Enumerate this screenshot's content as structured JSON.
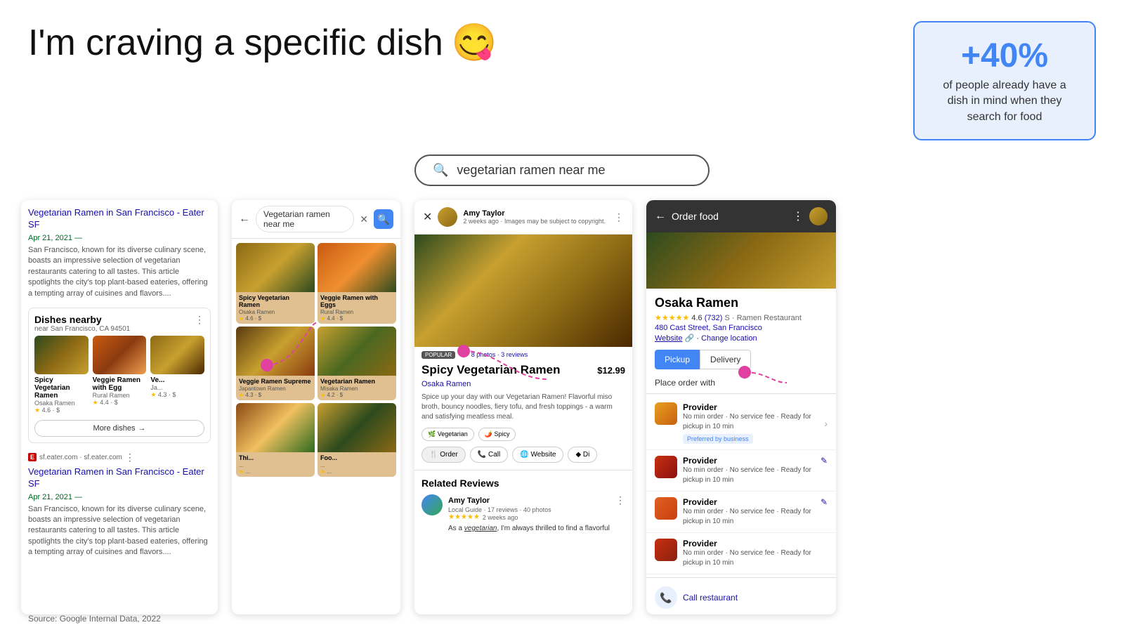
{
  "header": {
    "title": "I'm craving a specific dish",
    "emoji": "😋",
    "stat": {
      "number": "+40%",
      "text": "of people already have a dish in mind when they search for food"
    }
  },
  "search": {
    "placeholder": "vegetarian ramen near me",
    "query": "vegetarian ramen near me"
  },
  "panel1": {
    "article1": {
      "title": "Vegetarian Ramen in San Francisco - Eater SF",
      "date": "Apr 21, 2021",
      "text": "San Francisco, known for its diverse culinary scene, boasts an impressive selection of vegetarian restaurants catering to all tastes. This article spotlights the city's top plant-based eateries, offering a tempting array of cuisines and flavors...."
    },
    "dishes_nearby": {
      "title": "Dishes nearby",
      "location": "near San Francisco, CA 94501",
      "dishes": [
        {
          "name": "Spicy Vegetarian Ramen",
          "restaurant": "Osaka Ramen",
          "rating": "4.6",
          "price": "$"
        },
        {
          "name": "Veggie Ramen with Egg",
          "restaurant": "Rural Ramen",
          "rating": "4.4",
          "price": "$"
        },
        {
          "name": "Ve...",
          "restaurant": "Ja...",
          "rating": "4.3",
          "price": "$"
        }
      ],
      "more_btn": "More dishes"
    },
    "article2": {
      "source": "sf.eater.com",
      "source_url": "sf.eater.com",
      "title": "Vegetarian Ramen in San Francisco - Eater SF",
      "date": "Apr 21, 2021",
      "text": "San Francisco, known for its diverse culinary scene, boasts an impressive selection of vegetarian restaurants catering to all tastes. This article spotlights the city's top plant-based eateries, offering a tempting array of cuisines and flavors...."
    }
  },
  "panel2": {
    "search_query": "Vegetarian ramen near me",
    "images": [
      {
        "name": "Spicy Vegetarian Ramen",
        "restaurant": "Osaka Ramen",
        "rating": "4.6",
        "price": "$"
      },
      {
        "name": "Veggie Ramen with Eggs",
        "restaurant": "Rural Ramen",
        "rating": "4.4",
        "price": "$"
      },
      {
        "name": "Veggie Ramen Supreme",
        "restaurant": "Japantown Ramen",
        "rating": "4.3",
        "price": "$"
      },
      {
        "name": "Vegetarian Ramen",
        "restaurant": "Misaka Ramen",
        "rating": "4.2",
        "price": "$"
      },
      {
        "name": "...",
        "restaurant": "...",
        "rating": "...",
        "price": "$"
      },
      {
        "name": "...",
        "restaurant": "...",
        "rating": "...",
        "price": "$"
      }
    ]
  },
  "panel3": {
    "poster": "Amy Taylor",
    "poster_sub": "2 weeks ago",
    "copyright": "Images may be subject to copyright.",
    "popular_label": "POPULAR",
    "photos_reviews": "8 photos · 3 reviews",
    "dish_name": "Spicy Vegetarian Ramen",
    "dish_price": "$12.99",
    "restaurant": "Osaka Ramen",
    "description": "Spice up your day with our Vegetarian Ramen! Flavorful miso broth, bouncy noodles, fiery tofu, and fresh toppings - a warm and satisfying meatless meal.",
    "tags": [
      "🌿 Vegetarian",
      "🌶️ Spicy"
    ],
    "actions": [
      "🍴 Order",
      "📞 Call",
      "🌐 Website",
      "◆ Di..."
    ],
    "reviews": {
      "title": "Related Reviews",
      "reviewer": "Amy Taylor",
      "reviewer_sub": "Local Guide · 17 reviews · 40 photos",
      "stars": "★★★★★",
      "date": "2 weeks ago",
      "text": "As a vegetarian, I'm always thrilled to find a flavorful"
    }
  },
  "panel4": {
    "title": "Order food",
    "restaurant_name": "Osaka Ramen",
    "rating": "4.6",
    "rating_count": "(732)",
    "restaurant_type": "S · Ramen Restaurant",
    "address": "480 Cast Street, San Francisco",
    "website_label": "Website",
    "change_location": "Change location",
    "pickup_label": "Pickup",
    "delivery_label": "Delivery",
    "place_order_with": "Place order with",
    "providers": [
      {
        "name": "Provider",
        "details": "No min order · No service fee · Ready for pickup in 10 min",
        "preferred": true,
        "preferred_label": "Preferred by business"
      },
      {
        "name": "Provider",
        "details": "No min order · No service fee · Ready for pickup in 10 min",
        "preferred": false
      },
      {
        "name": "Provider",
        "details": "No min order · No service fee · Ready for pickup in 10 min",
        "preferred": false
      },
      {
        "name": "Provider",
        "details": "No min order · No service fee · Ready for pickup in 10 min",
        "preferred": false
      }
    ],
    "call_label": "Call restaurant"
  },
  "source": "Source: Google Internal Data, 2022"
}
